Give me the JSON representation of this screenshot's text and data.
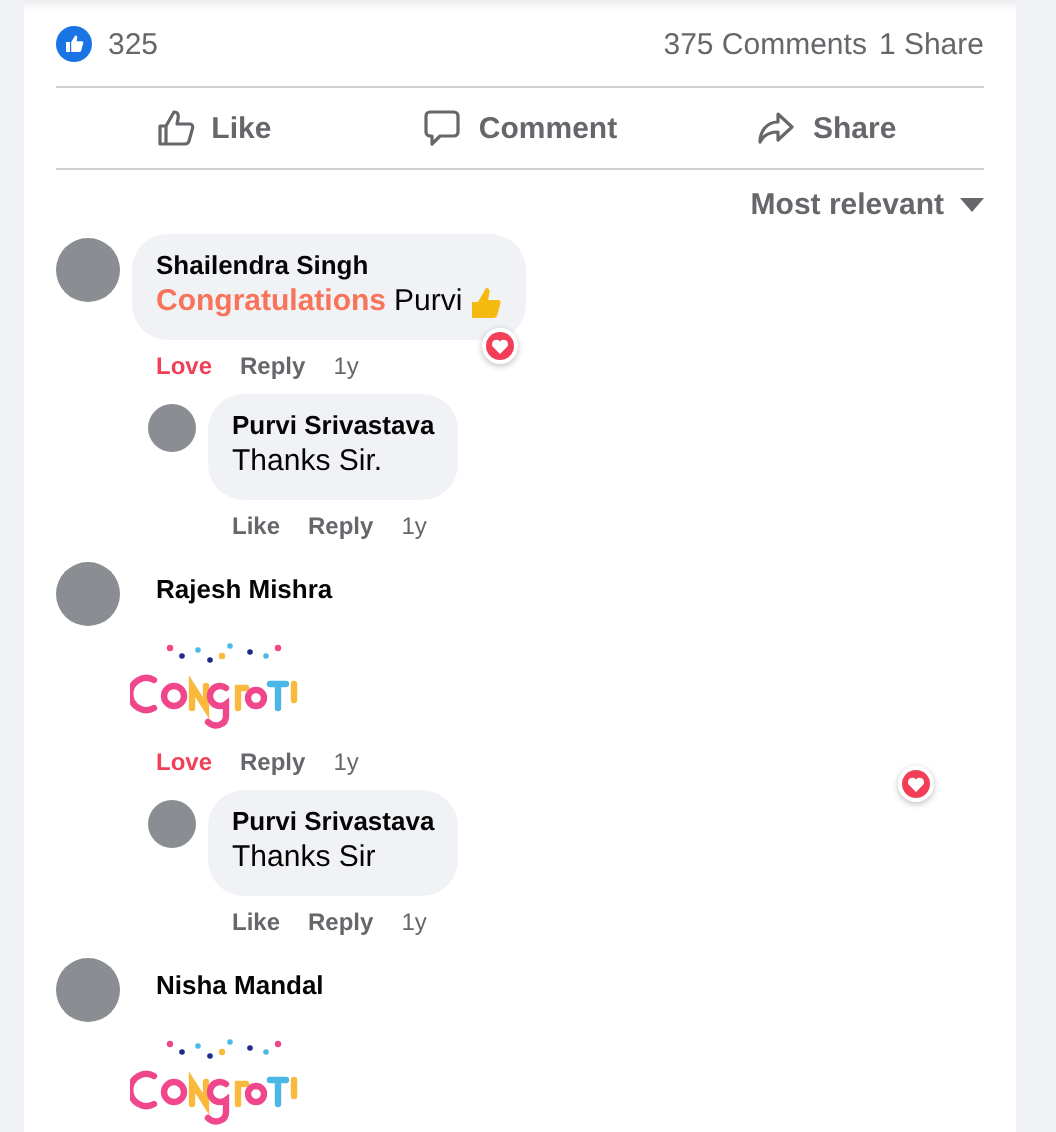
{
  "summary": {
    "reactions": "325",
    "comments": "375 Comments",
    "shares": "1 Share"
  },
  "actions": [
    {
      "label": "Like",
      "kind": "like"
    },
    {
      "label": "Comment",
      "kind": "comment"
    },
    {
      "label": "Share",
      "kind": "share"
    }
  ],
  "sort": {
    "label": "Most relevant"
  },
  "comments": [
    {
      "author": "Shailendra Singh",
      "body": [
        {
          "text": "Congratulations",
          "kind": "highlight"
        },
        {
          "text": "Purvi",
          "kind": "plain"
        },
        {
          "kind": "thumbs-emoji"
        }
      ],
      "react_label": "Love",
      "reacted": true,
      "reply": "Reply",
      "time": "1y",
      "badge": true,
      "replies": [
        {
          "author": "Purvi Srivastava",
          "body": [
            {
              "text": "Thanks Sir.",
              "kind": "plain"
            }
          ],
          "react_label": "Like",
          "reacted": false,
          "reply": "Reply",
          "time": "1y"
        }
      ]
    },
    {
      "author": "Rajesh Mishra",
      "kind": "sticker",
      "react_label": "Love",
      "reacted": true,
      "reply": "Reply",
      "time": "1y",
      "badge": true,
      "replies": [
        {
          "author": "Purvi Srivastava",
          "body": [
            {
              "text": "Thanks Sir",
              "kind": "plain"
            }
          ],
          "react_label": "Like",
          "reacted": false,
          "reply": "Reply",
          "time": "1y"
        }
      ]
    },
    {
      "author": "Nisha Mandal",
      "kind": "sticker"
    }
  ]
}
